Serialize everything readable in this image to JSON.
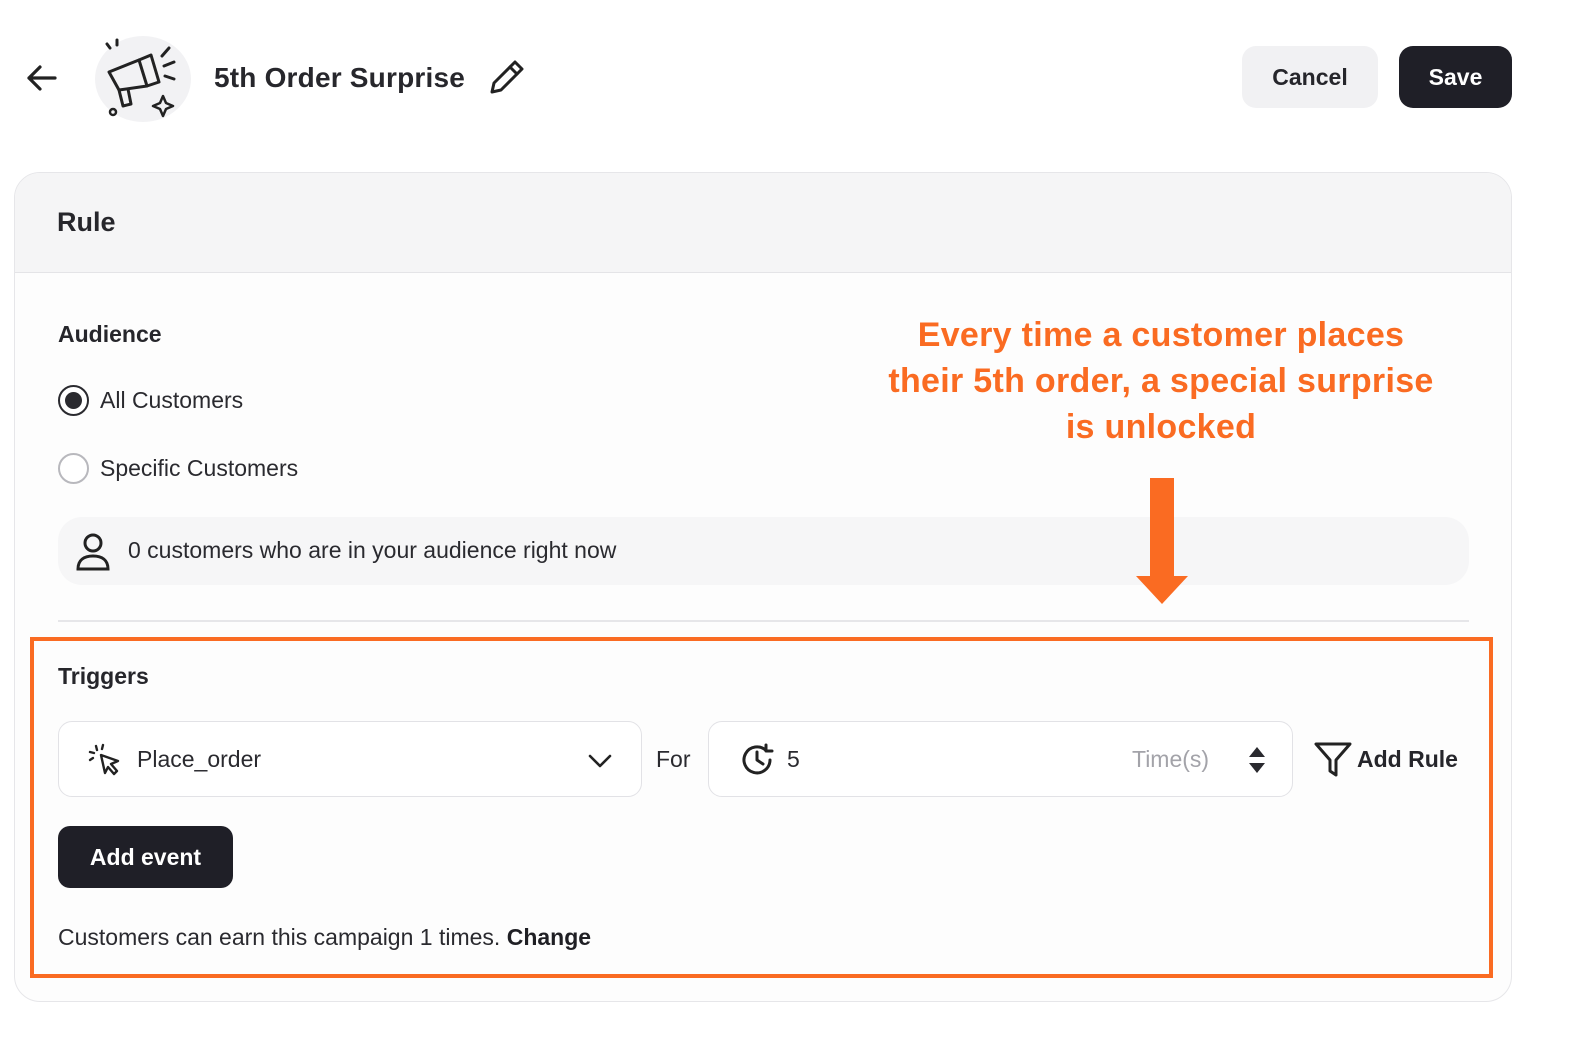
{
  "header": {
    "title": "5th Order Surprise",
    "cancel_label": "Cancel",
    "save_label": "Save"
  },
  "rule_card": {
    "title": "Rule",
    "audience": {
      "label": "Audience",
      "options": [
        {
          "label": "All Customers",
          "selected": true
        },
        {
          "label": "Specific Customers",
          "selected": false
        }
      ],
      "info_text": "0 customers who are in your audience right now"
    },
    "triggers": {
      "label": "Triggers",
      "event_value": "Place_order",
      "for_label": "For",
      "count_value": "5",
      "count_unit_placeholder": "Time(s)",
      "add_rule_label": "Add Rule",
      "add_event_label": "Add event",
      "earn_text": "Customers can earn this campaign 1 times.",
      "change_label": "Change"
    }
  },
  "annotation": {
    "text": "Every time a customer places their 5th order, a special surprise is unlocked",
    "color": "#fa6b22"
  },
  "icons": {
    "back": "arrow-left-icon",
    "campaign": "megaphone-icon",
    "edit": "pencil-icon",
    "person": "person-icon",
    "event": "cursor-click-icon",
    "chevron": "chevron-down-icon",
    "clock": "clock-icon",
    "stepper": "stepper-icon",
    "filter": "filter-icon"
  },
  "colors": {
    "primary_button": "#1f1f27",
    "secondary_button": "#f1f1f3",
    "accent": "#fa6b22"
  }
}
